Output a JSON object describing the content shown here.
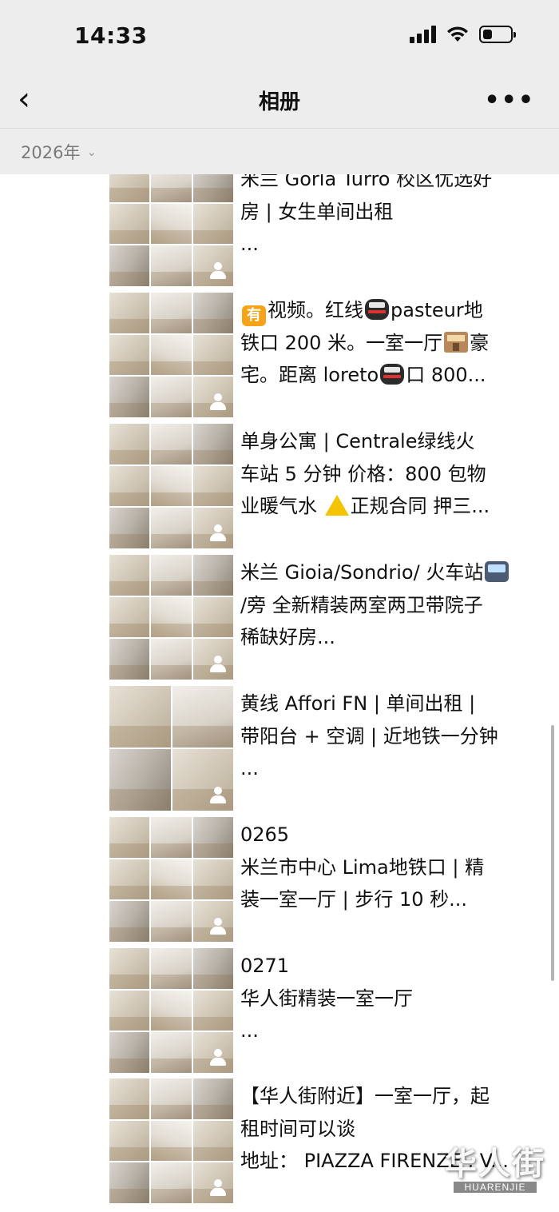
{
  "status_bar": {
    "time": "14:33"
  },
  "nav": {
    "back_icon": "chevron-left-icon",
    "title": "相册",
    "more_label": "•••"
  },
  "filter": {
    "year": "2026年",
    "chevron": "⌄"
  },
  "posts": [
    {
      "lines": [
        "米兰 Gorla Turro 校区优选好",
        "房 | 女生单间出租",
        "..."
      ]
    },
    {
      "lines": [
        "视频。红线",
        "pasteur地",
        "铁口 200 米。一室一厅",
        "豪",
        "宅。距离 loreto",
        "口 800..."
      ]
    },
    {
      "lines": [
        "单身公寓 | Centrale绿线火",
        "车站 5 分钟 价格：800 包物",
        "业暖气水 ",
        "正规合同 押三..."
      ]
    },
    {
      "lines": [
        "米兰 Gioia/Sondrio/ 火车站",
        "/旁 全新精装两室两卫带院子",
        "稀缺好房..."
      ]
    },
    {
      "lines": [
        "黄线 Affori FN | 单间出租 |",
        "带阳台 + 空调 | 近地铁一分钟",
        "..."
      ]
    },
    {
      "lines": [
        "0265",
        "米兰市中心 Lima地铁口 | 精",
        "装一室一厅 | 步行 10 秒..."
      ]
    },
    {
      "lines": [
        "0271",
        "华人街精装一室一厅",
        "..."
      ]
    },
    {
      "lines": [
        "【华人街附近】一室一厅，起",
        "租时间可以谈",
        "地址： PIAZZA FIRENZE , V..."
      ]
    }
  ],
  "emoji": {
    "you_char": "有"
  },
  "watermark": {
    "cn": "华人街",
    "en": "HUARENJIE"
  }
}
